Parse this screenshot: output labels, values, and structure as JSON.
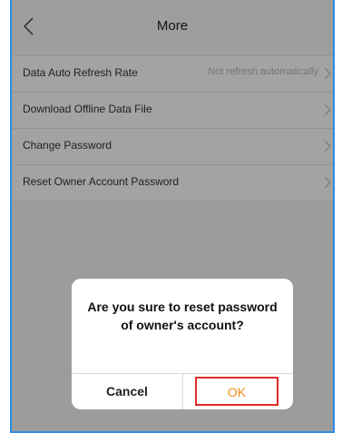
{
  "header": {
    "title": "More"
  },
  "settings": {
    "items": [
      {
        "label": "Data Auto Refresh Rate",
        "value": "Not refresh automatically"
      },
      {
        "label": "Download Offline Data File",
        "value": ""
      },
      {
        "label": "Change Password",
        "value": ""
      },
      {
        "label": "Reset Owner Account Password",
        "value": ""
      }
    ]
  },
  "dialog": {
    "message": "Are you sure to reset password of owner's account?",
    "cancel_label": "Cancel",
    "ok_label": "OK"
  },
  "colors": {
    "frame_border": "#2f8de4",
    "ok_text": "#f08c1a",
    "highlight_box": "#e02b2b"
  }
}
